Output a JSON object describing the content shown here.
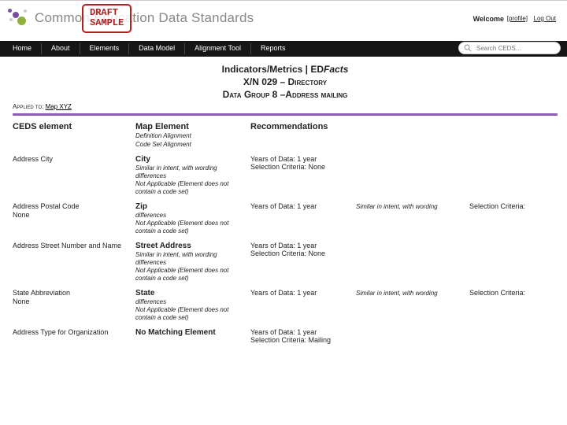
{
  "header": {
    "brand_html": "Common Education Data Standards",
    "draft_line1": "DRAFT",
    "draft_line2": "SAMPLE",
    "welcome": "Welcome",
    "profile": "[profile]",
    "logout": "Log Out"
  },
  "nav": {
    "items": [
      "Home",
      "About",
      "Elements",
      "Data Model",
      "Alignment Tool",
      "Reports"
    ],
    "search_placeholder": "Search CEDS..."
  },
  "title": {
    "line1_a": "Indicators/Metrics | ED",
    "line1_b": "Facts",
    "line2": "X/N 029 – Directory",
    "line3": "Data Group 8 –Address mailing"
  },
  "applied_to_label": "Applied to: ",
  "applied_to_link": "Map XYZ",
  "headers": {
    "ceds": "CEDS element",
    "map": "Map Element",
    "map_sub1": "Definition Alignment",
    "map_sub2": "Code Set Alignment",
    "rec": "Recommendations"
  },
  "rows": [
    {
      "ceds": "Address City",
      "map_el": "City",
      "map_sub": "Similar in intent, with wording differences\nNot Applicable (Element does not contain a code set)",
      "rec": "Years of Data: 1 year\nSelection Criteria: None",
      "col4": "",
      "col5": ""
    },
    {
      "ceds": "Address Postal Code\nNone",
      "map_el": "Zip",
      "map_sub": "differences\nNot Applicable (Element does not contain a code set)",
      "rec": "Years of Data: 1 year",
      "col4": "Similar in intent, with wording",
      "col5": "Selection Criteria:"
    },
    {
      "ceds": "Address Street Number and Name",
      "map_el": "Street Address",
      "map_sub": "Similar in intent, with wording differences\nNot Applicable (Element does not contain a code set)",
      "rec": "Years of Data: 1 year\nSelection Criteria: None",
      "col4": "",
      "col5": ""
    },
    {
      "ceds": "State Abbreviation\nNone",
      "map_el": "State",
      "map_sub": "differences\nNot Applicable (Element does not contain a code set)",
      "rec": "Years of Data: 1 year",
      "col4": "Similar in intent, with wording",
      "col5": "Selection Criteria:"
    },
    {
      "ceds": "Address Type for Organization",
      "map_el": "No Matching Element",
      "map_sub": "",
      "rec": "Years of Data: 1 year\nSelection Criteria: Mailing",
      "col4": "",
      "col5": ""
    }
  ]
}
